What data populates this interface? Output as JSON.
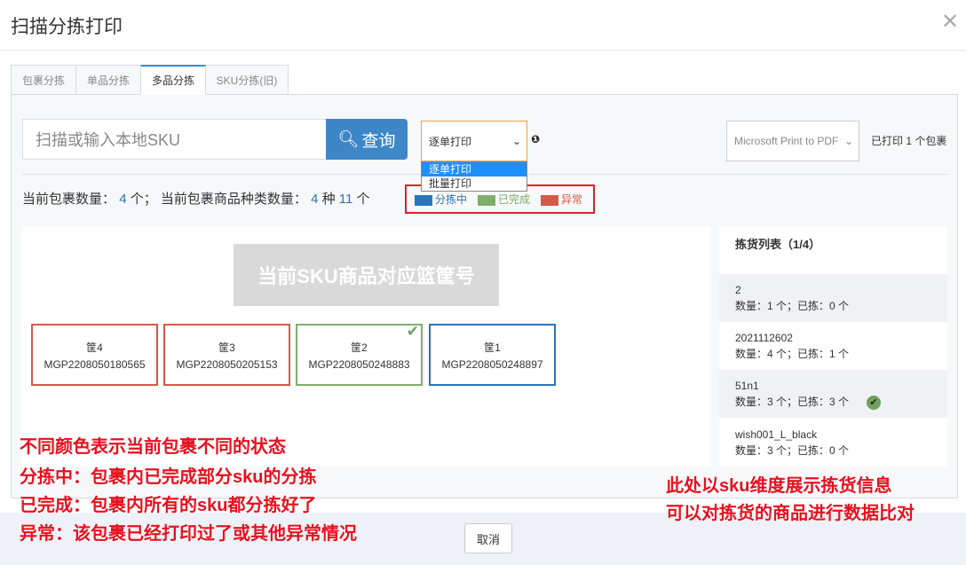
{
  "window": {
    "title": "扫描分拣打印",
    "close": "✕"
  },
  "tabs": [
    {
      "label": "包裹分拣"
    },
    {
      "label": "单品分拣"
    },
    {
      "label": "多品分拣",
      "active": true
    },
    {
      "label": "SKU分拣(旧)"
    }
  ],
  "search": {
    "placeholder": "扫描或输入本地SKU",
    "button": "查询"
  },
  "print_mode": {
    "selected": "逐单打印",
    "options": [
      "逐单打印",
      "批量打印"
    ],
    "info": "❶"
  },
  "printer": {
    "selected": "Microsoft Print to PDF"
  },
  "printed_count": "已打印 1 个包裹",
  "stats": {
    "pkg_label": "当前包裹数量：",
    "pkg_count": "4",
    "pkg_unit": "个；",
    "kind_label": "当前包裹商品种类数量：",
    "kinds": "4",
    "kind_unit": "种",
    "items": "11",
    "item_unit": "个"
  },
  "legend": [
    {
      "label": "分拣中",
      "color": "#2a75b8"
    },
    {
      "label": "已完成",
      "color": "#7fae6a"
    },
    {
      "label": "异常",
      "color": "#d45a48"
    }
  ],
  "banner": "当前SKU商品对应篮筐号",
  "baskets": [
    {
      "name": "筐4",
      "order": "MGP2208050180565",
      "status": "异常",
      "color": "#d45a48"
    },
    {
      "name": "筐3",
      "order": "MGP2208050205153",
      "status": "异常",
      "color": "#d45a48"
    },
    {
      "name": "筐2",
      "order": "MGP2208050248883",
      "status": "已完成",
      "color": "#7fae6a",
      "checked": true
    },
    {
      "name": "筐1",
      "order": "MGP2208050248897",
      "status": "分拣中",
      "color": "#2a75b8"
    }
  ],
  "pick_list": {
    "title": "拣货列表（1/4）",
    "items": [
      {
        "sku": "2",
        "detail": "数量：1 个；已拣：0 个"
      },
      {
        "sku": "2021112602",
        "detail": "数量：4 个；已拣：1 个"
      },
      {
        "sku": "51n1",
        "detail": "数量：3 个；已拣：3 个",
        "done": true
      },
      {
        "sku": "wish001_L_black",
        "detail": "数量：3 个；已拣：0 个"
      }
    ]
  },
  "footer": {
    "cancel": "取消"
  },
  "annotations": {
    "left": [
      "不同颜色表示当前包裹不同的状态",
      "分拣中：包裹内已完成部分sku的分拣",
      "已完成：包裹内所有的sku都分拣好了",
      "异常：该包裹已经打印过了或其他异常情况"
    ],
    "right": [
      "此处以sku维度展示拣货信息",
      "可以对拣货的商品进行数据比对"
    ]
  }
}
